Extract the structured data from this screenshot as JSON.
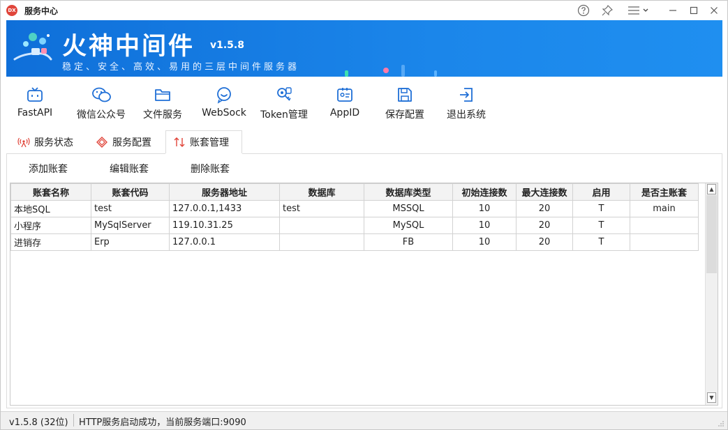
{
  "window": {
    "title": "服务中心",
    "app_icon_text": "DX",
    "controls": [
      "help-icon",
      "pin-icon",
      "menu-icon",
      "minimize-icon",
      "maximize-icon",
      "close-icon"
    ]
  },
  "banner": {
    "title": "火神中间件",
    "version": "v1.5.8",
    "subtitle": "稳定、安全、高效、易用的三层中间件服务器",
    "background": "#1480e6"
  },
  "toolbar": {
    "items": [
      {
        "label": "FastAPI",
        "icon": "tv-icon"
      },
      {
        "label": "微信公众号",
        "icon": "wechat-icon"
      },
      {
        "label": "文件服务",
        "icon": "folder-icon"
      },
      {
        "label": "WebSock",
        "icon": "chat-bubble-icon"
      },
      {
        "label": "Token管理",
        "icon": "key-badge-icon"
      },
      {
        "label": "AppID",
        "icon": "id-card-icon"
      },
      {
        "label": "保存配置",
        "icon": "save-icon"
      },
      {
        "label": "退出系统",
        "icon": "exit-icon"
      }
    ]
  },
  "tabs": [
    {
      "label": "服务状态",
      "icon": "signal-icon",
      "active": false
    },
    {
      "label": "服务配置",
      "icon": "config-icon",
      "active": false
    },
    {
      "label": "账套管理",
      "icon": "sort-arrows-icon",
      "active": true
    }
  ],
  "actions": [
    "添加账套",
    "编辑账套",
    "删除账套"
  ],
  "grid": {
    "columns": [
      "账套名称",
      "账套代码",
      "服务器地址",
      "数据库",
      "数据库类型",
      "初始连接数",
      "最大连接数",
      "启用",
      "是否主账套"
    ],
    "rows": [
      [
        "本地SQL",
        "test",
        "127.0.0.1,1433",
        "test",
        "MSSQL",
        "10",
        "20",
        "T",
        "main"
      ],
      [
        "小程序",
        "MySqlServer",
        "119.10.31.25",
        "",
        "MySQL",
        "10",
        "20",
        "T",
        ""
      ],
      [
        "进销存",
        "Erp",
        "127.0.0.1",
        "",
        "FB",
        "10",
        "20",
        "T",
        ""
      ]
    ]
  },
  "status": {
    "version": "v1.5.8 (32位)",
    "message": "HTTP服务启动成功，当前服务端口:9090"
  }
}
